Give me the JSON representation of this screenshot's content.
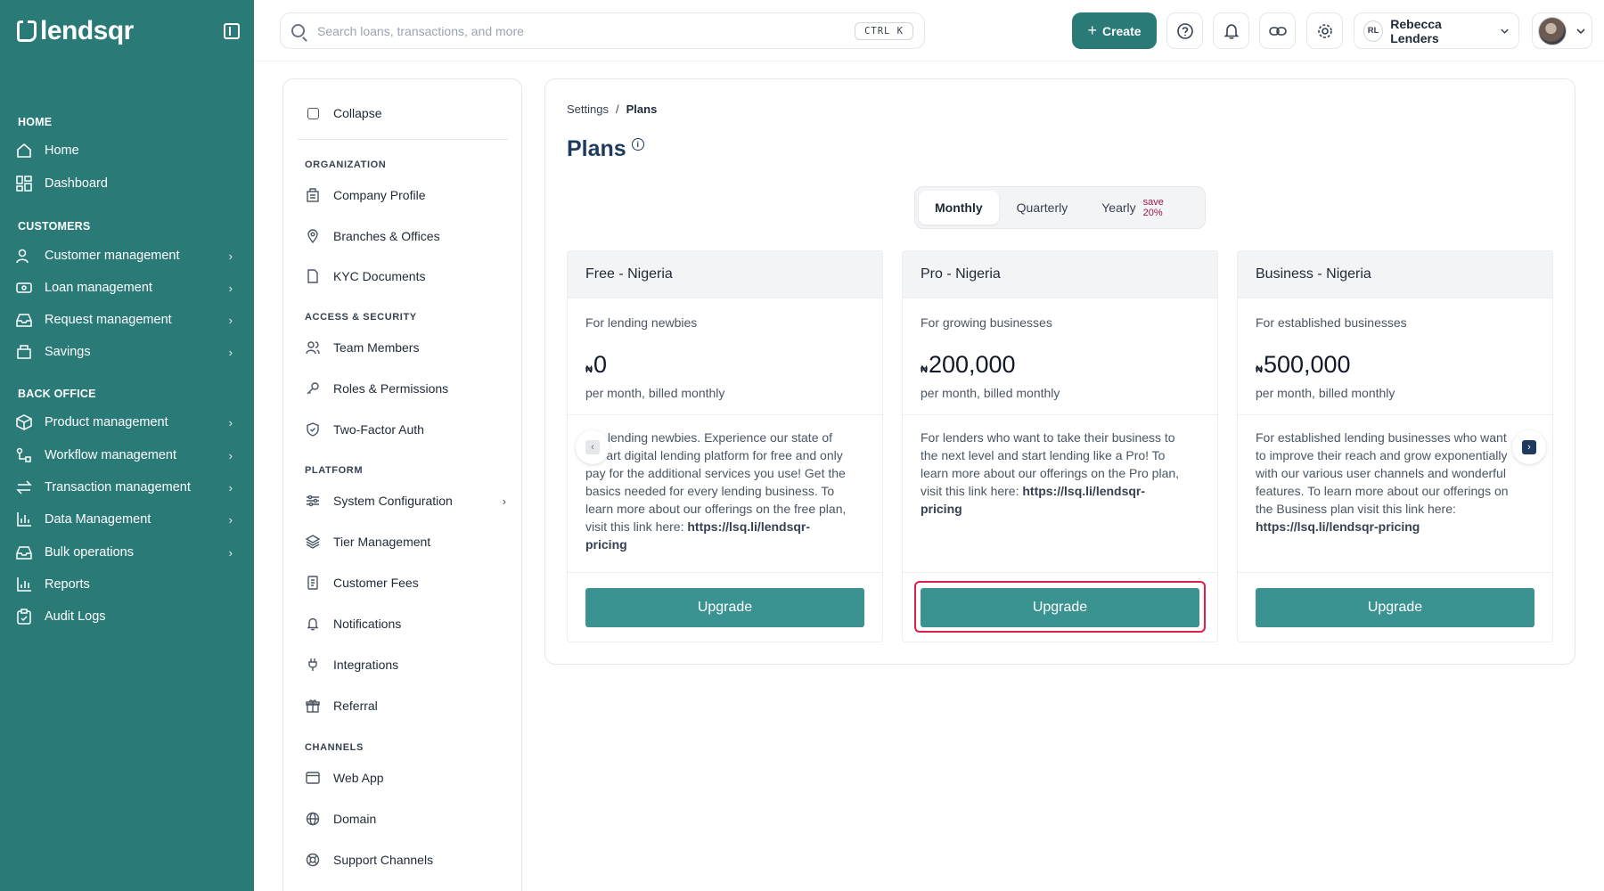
{
  "brand": {
    "name": "lendsqr"
  },
  "sidebar": {
    "sections": {
      "home": "HOME",
      "customers": "CUSTOMERS",
      "back_office": "BACK OFFICE"
    },
    "items": [
      {
        "label": "Home",
        "icon": "home-icon"
      },
      {
        "label": "Dashboard",
        "icon": "dashboard-icon"
      },
      {
        "label": "Customer management",
        "icon": "users-icon"
      },
      {
        "label": "Loan management",
        "icon": "loan-icon"
      },
      {
        "label": "Request management",
        "icon": "inbox-icon"
      },
      {
        "label": "Savings",
        "icon": "savings-icon"
      },
      {
        "label": "Product management",
        "icon": "box-icon"
      },
      {
        "label": "Workflow management",
        "icon": "workflow-icon"
      },
      {
        "label": "Transaction management",
        "icon": "transfer-icon"
      },
      {
        "label": "Data Management",
        "icon": "bar-chart-icon"
      },
      {
        "label": "Bulk operations",
        "icon": "tray-icon"
      },
      {
        "label": "Reports",
        "icon": "reports-icon"
      },
      {
        "label": "Audit Logs",
        "icon": "clipboard-icon"
      }
    ]
  },
  "topbar": {
    "search_placeholder": "Search loans, transactions, and more",
    "shortcut": "CTRL K",
    "create_label": "Create",
    "user_initials": "RL",
    "user_name": "Rebecca Lenders"
  },
  "settings_nav": {
    "collapse_label": "Collapse",
    "sections": {
      "organization": "ORGANIZATION",
      "access_security": "ACCESS & SECURITY",
      "platform": "PLATFORM",
      "channels": "CHANNELS"
    },
    "items": [
      {
        "label": "Company Profile",
        "icon": "building-icon"
      },
      {
        "label": "Branches & Offices",
        "icon": "location-pin-icon"
      },
      {
        "label": "KYC Documents",
        "icon": "document-icon"
      },
      {
        "label": "Team Members",
        "icon": "team-icon"
      },
      {
        "label": "Roles & Permissions",
        "icon": "key-icon"
      },
      {
        "label": "Two-Factor Auth",
        "icon": "shield-icon"
      },
      {
        "label": "System Configuration",
        "icon": "sliders-icon"
      },
      {
        "label": "Tier Management",
        "icon": "layers-icon"
      },
      {
        "label": "Customer Fees",
        "icon": "receipt-icon"
      },
      {
        "label": "Notifications",
        "icon": "bell-icon"
      },
      {
        "label": "Integrations",
        "icon": "plug-icon"
      },
      {
        "label": "Referral",
        "icon": "gift-icon"
      },
      {
        "label": "Web App",
        "icon": "browser-icon"
      },
      {
        "label": "Domain",
        "icon": "globe-icon"
      },
      {
        "label": "Support Channels",
        "icon": "lifebuoy-icon"
      }
    ]
  },
  "main": {
    "breadcrumb": {
      "parent": "Settings",
      "separator": "/",
      "current": "Plans"
    },
    "title": "Plans",
    "billing_toggle": {
      "options": [
        "Monthly",
        "Quarterly",
        "Yearly"
      ],
      "selected": "Monthly",
      "save_note": "save 20%"
    },
    "plans": [
      {
        "name": "Free - Nigeria",
        "subtitle": "For lending newbies",
        "currency": "₦",
        "price": "0",
        "billing": "per month, billed monthly",
        "desc_lines": [
          "For lending newbies. Experience our state of",
          "the art digital lending platform for free and only",
          "pay for the additional services you use! Get the",
          "basics needed for every lending business. To",
          "learn more about our offerings on the free plan,",
          "visit this link here: "
        ],
        "link_line1": "https://lsq.li/lendsqr-",
        "link_line2": "pricing",
        "button": "Upgrade"
      },
      {
        "name": "Pro - Nigeria",
        "subtitle": "For growing businesses",
        "currency": "₦",
        "price": "200,000",
        "billing": "per month, billed monthly",
        "desc_lines": [
          "For lenders who want to take their business to",
          "the next level and start lending like a Pro! To",
          "learn more about our offerings on the Pro plan,",
          "visit this link here: "
        ],
        "link_line1": "https://lsq.li/lendsqr-",
        "link_line2": "pricing",
        "button": "Upgrade"
      },
      {
        "name": "Business - Nigeria",
        "subtitle": "For established businesses",
        "currency": "₦",
        "price": "500,000",
        "billing": "per month, billed monthly",
        "desc_lines": [
          "For established lending businesses who want",
          "to improve their reach and grow exponentially",
          "with our various user channels and wonderful",
          "features. To learn more about our offerings on",
          "the Business plan visit this link here:"
        ],
        "link_line1": "https://lsq.li/lendsqr-pricing",
        "link_line2": "",
        "button": "Upgrade"
      }
    ]
  },
  "colors": {
    "sidebar_bg": "#2a7a78",
    "primary_button": "#3a9390",
    "title_color": "#1e3a5f",
    "highlight": "#e11d48"
  }
}
